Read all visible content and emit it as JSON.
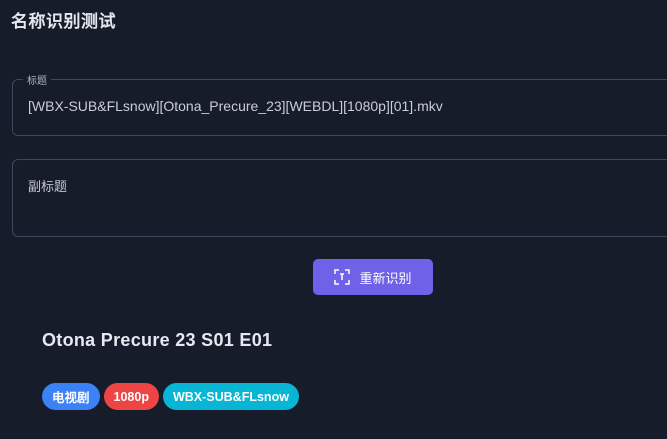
{
  "page": {
    "title": "名称识别测试"
  },
  "title_field": {
    "label": "标题",
    "value": "[WBX-SUB&FLsnow][Otona_Precure_23][WEBDL][1080p][01].mkv"
  },
  "subtitle_field": {
    "label": "副标题",
    "value": ""
  },
  "recognize_button": {
    "label": "重新识别",
    "icon": "scan-icon"
  },
  "result": {
    "title": "Otona Precure 23 S01 E01",
    "tags": [
      {
        "label": "电视剧",
        "color": "#3b82f6"
      },
      {
        "label": "1080p",
        "color": "#ef4444"
      },
      {
        "label": "WBX-SUB&FLsnow",
        "color": "#06b6d4"
      }
    ]
  }
}
